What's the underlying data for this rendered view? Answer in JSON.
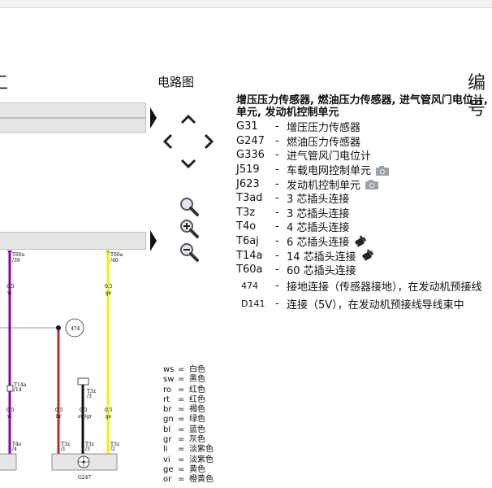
{
  "header": {
    "left_fragment": "工",
    "circuit_label": "电路图",
    "right_fragment": "编号"
  },
  "nav": {
    "up": "up-arrow",
    "left": "left-arrow",
    "right": "right-arrow",
    "down": "down-arrow",
    "zoom_fit": "magnifier-icon",
    "zoom_in": "zoom-in-icon",
    "zoom_out": "zoom-out-icon"
  },
  "info": {
    "title_line1": "增压压力传感器, 燃油压力传感器, 进气管风门电位计,",
    "title_line2": "单元, 发动机控制单元",
    "items": [
      {
        "code": "G31",
        "desc": "增压压力传感器",
        "icon": ""
      },
      {
        "code": "G247",
        "desc": "燃油压力传感器",
        "icon": ""
      },
      {
        "code": "G336",
        "desc": "进气管风门电位计",
        "icon": ""
      },
      {
        "code": "J519",
        "desc": "车载电网控制单元",
        "icon": "camera-icon"
      },
      {
        "code": "J623",
        "desc": "发动机控制单元",
        "icon": "camera-icon"
      },
      {
        "code": "T3ad",
        "desc": "3 芯插头连接",
        "icon": ""
      },
      {
        "code": "T3z",
        "desc": "3 芯插头连接",
        "icon": ""
      },
      {
        "code": "T4o",
        "desc": "4 芯插头连接",
        "icon": ""
      },
      {
        "code": "T6aj",
        "desc": "6 芯插头连接",
        "icon": "connector-icon"
      },
      {
        "code": "T14a",
        "desc": "14 芯插头连接",
        "icon": "connector-icon"
      },
      {
        "code": "T60a",
        "desc": "60 芯插头连接",
        "icon": ""
      },
      {
        "code": "474",
        "desc": "接地连接（传感器接地），在发动机预接线",
        "icon": ""
      },
      {
        "code": "D141",
        "desc": "连接（5V），在发动机预接线导线束中",
        "icon": ""
      }
    ],
    "dash": "-"
  },
  "legend": [
    {
      "code": "ws",
      "color": "白色"
    },
    {
      "code": "sw",
      "color": "黑色"
    },
    {
      "code": "ro",
      "color": "红色"
    },
    {
      "code": "rt",
      "color": "红色"
    },
    {
      "code": "br",
      "color": "褐色"
    },
    {
      "code": "gn",
      "color": "绿色"
    },
    {
      "code": "bl",
      "color": "蓝色"
    },
    {
      "code": "gr",
      "color": "灰色"
    },
    {
      "code": "li",
      "color": "淡紫色"
    },
    {
      "code": "vi",
      "color": "淡紫色"
    },
    {
      "code": "ge",
      "color": "黄色"
    },
    {
      "code": "or",
      "color": "橙黄色"
    }
  ],
  "legend_eq": "=",
  "diagram": {
    "wires": [
      {
        "top_label": "T60a",
        "top_pin": "/39",
        "gauge": "0.5",
        "color_code": "vi",
        "bottom_label": "T4o",
        "bottom_pin": "/4",
        "color": "#8b00a8"
      },
      {
        "top_label": "",
        "top_pin": "",
        "gauge": "0.5",
        "color_code": "br",
        "bottom_label": "T3z",
        "bottom_pin": "/1",
        "color": "#b03030"
      },
      {
        "top_label": "",
        "top_pin": "",
        "gauge": "0.5",
        "color_code": "sw/gr",
        "bottom_label": "T3z",
        "bottom_pin": "/3",
        "color": "#111111"
      },
      {
        "top_label": "T60a",
        "top_pin": "/40",
        "gauge": "0.5",
        "color_code": "ge",
        "bottom_label": "T3z",
        "bottom_pin": "/2",
        "color": "#f2ef00"
      }
    ],
    "ground_label": "474",
    "connector_label": "T14a",
    "connector_pin": "/14",
    "connector_right_label": "T3z",
    "connector_right_pin": "/3",
    "component_label": "G247"
  }
}
